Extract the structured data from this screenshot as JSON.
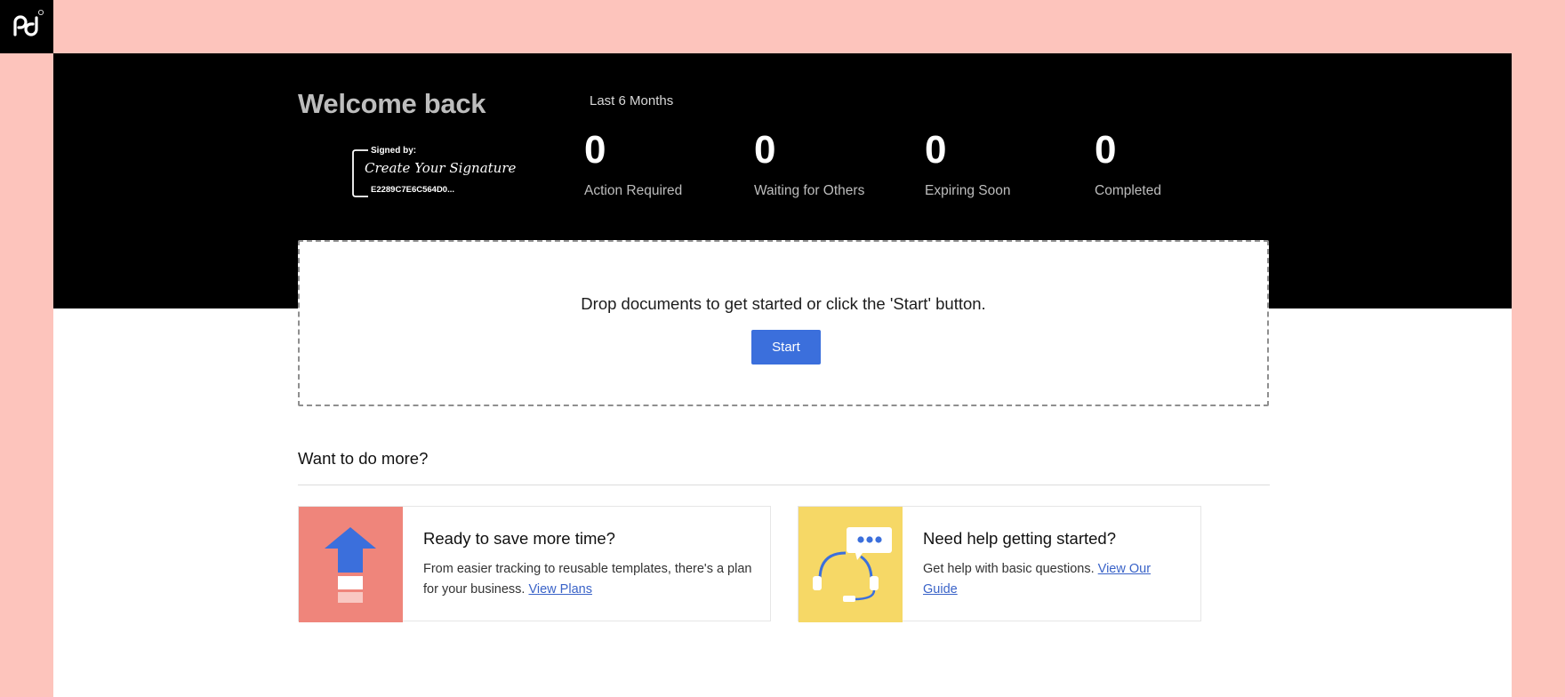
{
  "brand": {
    "logo_icon": "pandadoc-logo-icon"
  },
  "hero": {
    "welcome": "Welcome back",
    "signature": {
      "signed_by_label": "Signed by:",
      "signature_text": "Create Your Signature",
      "signature_id": "E2289C7E6C564D0..."
    },
    "period": "Last 6 Months",
    "stats": [
      {
        "value": "0",
        "label": "Action Required"
      },
      {
        "value": "0",
        "label": "Waiting for Others"
      },
      {
        "value": "0",
        "label": "Expiring Soon"
      },
      {
        "value": "0",
        "label": "Completed"
      }
    ]
  },
  "dropzone": {
    "text": "Drop documents to get started or click the 'Start' button.",
    "start_label": "Start"
  },
  "more": {
    "heading": "Want to do more?",
    "cards": [
      {
        "icon": "upgrade-arrow-icon",
        "title": "Ready to save more time?",
        "text": "From easier tracking to reusable templates, there's a plan for your business.",
        "link": "View Plans"
      },
      {
        "icon": "support-headset-icon",
        "title": "Need help getting started?",
        "text": "Get help with basic questions.",
        "link": "View Our Guide"
      }
    ]
  },
  "colors": {
    "page_background": "#fdc4bc",
    "hero_background": "#000000",
    "accent": "#3b6fdc",
    "plan_card_art": "#ef857b",
    "help_card_art": "#f6d866"
  }
}
